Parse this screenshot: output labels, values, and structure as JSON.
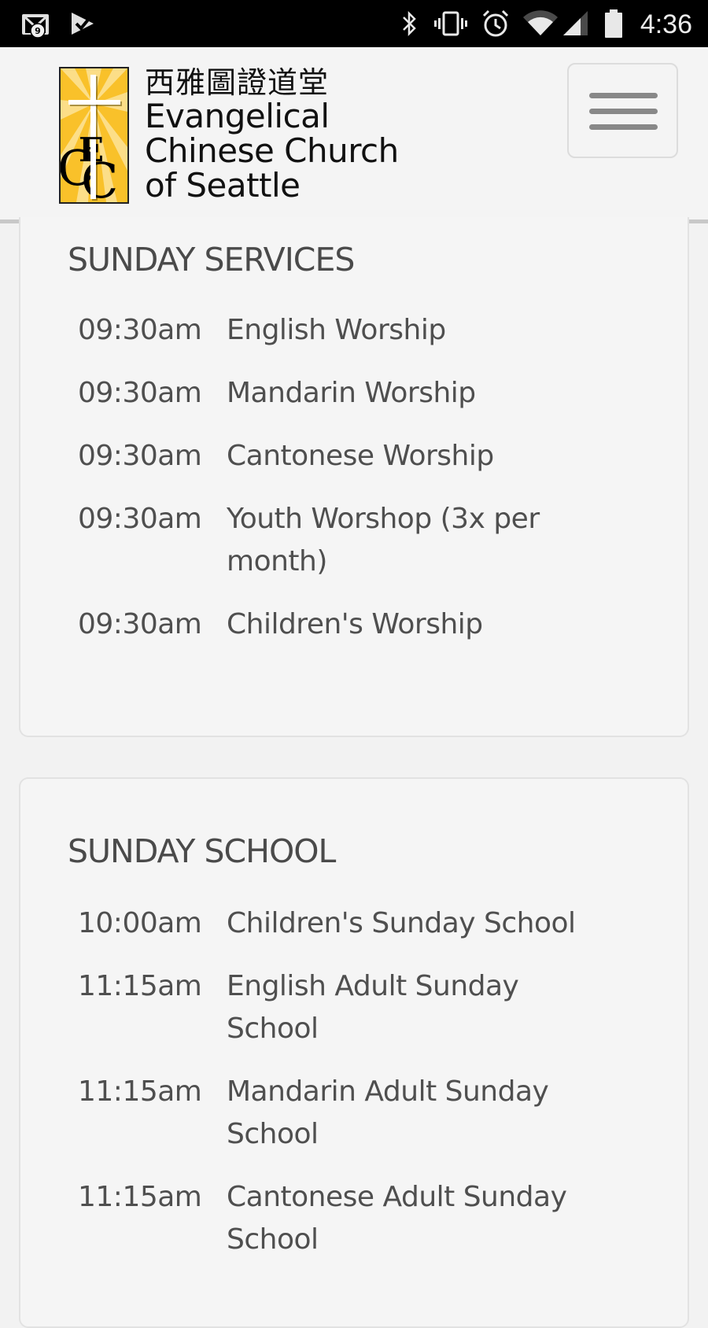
{
  "status_bar": {
    "notification_count": "9",
    "time": "4:36",
    "icons": [
      "gmail-icon",
      "play-store-check-icon",
      "bluetooth-icon",
      "vibrate-icon",
      "alarm-icon",
      "wifi-icon",
      "cell-signal-icon",
      "battery-icon"
    ]
  },
  "header": {
    "logo_chinese": "西雅圖證道堂",
    "logo_line1": "Evangelical",
    "logo_line2": "Chinese Church",
    "logo_line3": "of Seattle",
    "logo_monogram": "ECC",
    "menu_button_icon": "hamburger-menu-icon"
  },
  "sections": [
    {
      "title": "SUNDAY SERVICES",
      "items": [
        {
          "time": "09:30am",
          "name": "English Worship"
        },
        {
          "time": "09:30am",
          "name": "Mandarin Worship"
        },
        {
          "time": "09:30am",
          "name": "Cantonese Worship"
        },
        {
          "time": "09:30am",
          "name": "Youth Worshop (3x per month)"
        },
        {
          "time": "09:30am",
          "name": "Children's Worship"
        }
      ]
    },
    {
      "title": "SUNDAY SCHOOL",
      "items": [
        {
          "time": "10:00am",
          "name": "Children's Sunday School"
        },
        {
          "time": "11:15am",
          "name": "English Adult Sunday School"
        },
        {
          "time": "11:15am",
          "name": "Mandarin Adult Sunday School"
        },
        {
          "time": "11:15am",
          "name": "Cantonese Adult Sunday School"
        }
      ]
    }
  ],
  "colors": {
    "logo_gold": "#f9c12a",
    "text": "#4f4f4f",
    "header_bg": "#f4f4f4",
    "page_bg": "#f2f2f2"
  }
}
